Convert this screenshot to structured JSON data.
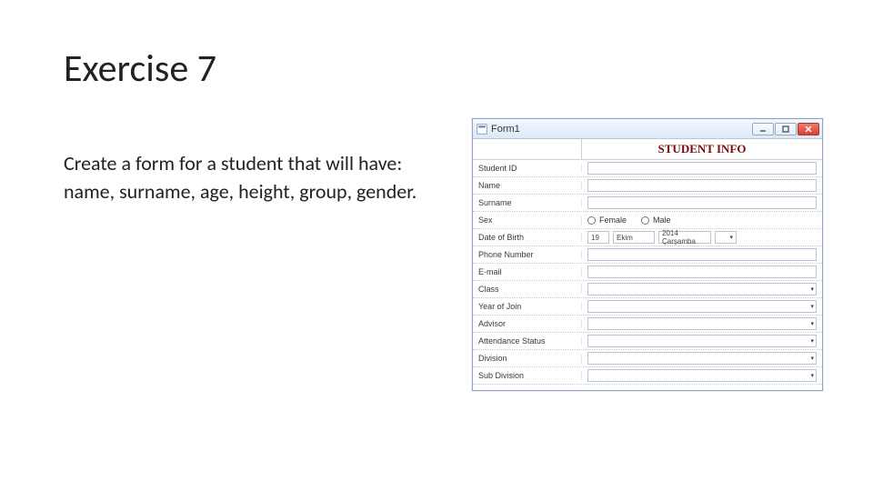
{
  "slide": {
    "title": "Exercise 7",
    "body": "Create a form for a student that will have: name, surname, age, height, group, gender."
  },
  "window": {
    "title": "Form1",
    "header": "STUDENT INFO",
    "fields": {
      "student_id": "Student ID",
      "name": "Name",
      "surname": "Surname",
      "sex": "Sex",
      "sex_female": "Female",
      "sex_male": "Male",
      "dob": "Date of Birth",
      "dob_day": "19",
      "dob_month": "Ekim",
      "dob_year": "2014 Çarşamba",
      "phone": "Phone Number",
      "email": "E-mail",
      "class": "Class",
      "year_of_join": "Year of Join",
      "advisor": "Advisor",
      "attendance": "Attendance Status",
      "division": "Division",
      "sub_division": "Sub Division"
    },
    "caret": "▾",
    "cal_caret": "▾"
  }
}
